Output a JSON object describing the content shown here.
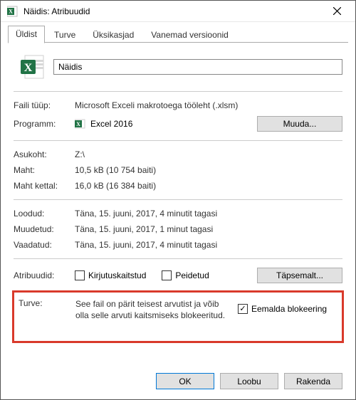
{
  "window": {
    "title": "Näidis: Atribuudid"
  },
  "tabs": {
    "general": "Üldist",
    "security": "Turve",
    "details": "Üksikasjad",
    "previous": "Vanemad versioonid"
  },
  "file": {
    "name": "Näidis"
  },
  "labels": {
    "type": "Faili tüüp:",
    "program": "Programm:",
    "location": "Asukoht:",
    "size": "Maht:",
    "size_on_disk": "Maht kettal:",
    "created": "Loodud:",
    "modified": "Muudetud:",
    "accessed": "Vaadatud:",
    "attributes": "Atribuudid:",
    "security": "Turve:"
  },
  "values": {
    "type": "Microsoft Exceli makrotoega tööleht (.xlsm)",
    "program": "Excel 2016",
    "location": "Z:\\",
    "size": "10,5 kB (10 754 baiti)",
    "size_on_disk": "16,0 kB (16 384 baiti)",
    "created": "Täna, 15. juuni, 2017, 4 minutit tagasi",
    "modified": "Täna, 15. juuni, 2017, 1 minut tagasi",
    "accessed": "Täna, 15. juuni, 2017, 4 minutit tagasi"
  },
  "buttons": {
    "change": "Muuda...",
    "advanced": "Täpsemalt...",
    "ok": "OK",
    "cancel": "Loobu",
    "apply": "Rakenda"
  },
  "attributes": {
    "readonly": "Kirjutuskaitstud",
    "hidden": "Peidetud"
  },
  "security": {
    "text": "See fail on pärit teisest arvutist ja võib olla selle arvuti kaitsmiseks blokeeritud.",
    "unblock": "Eemalda blokeering"
  }
}
